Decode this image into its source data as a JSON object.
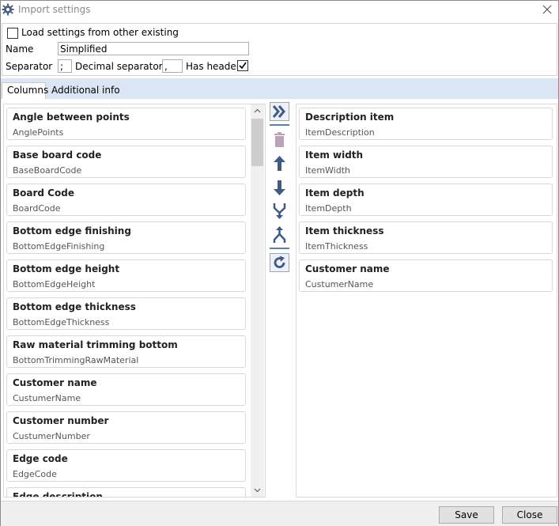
{
  "window": {
    "title": "Import settings"
  },
  "settings": {
    "load_other_label": "Load settings from other existing",
    "load_other_checked": false,
    "name_label": "Name",
    "name_value": "Simplified",
    "separator_label": "Separator",
    "separator_value": ";",
    "decimal_label": "Decimal separator",
    "decimal_value": ",",
    "has_header_label": "Has header",
    "has_header_checked": true
  },
  "tabs": [
    {
      "label": "Columns",
      "active": true
    },
    {
      "label": "Additional info",
      "active": false
    }
  ],
  "available_columns": [
    {
      "title": "Angle between points",
      "key": "AnglePoints"
    },
    {
      "title": "Base board code",
      "key": "BaseBoardCode"
    },
    {
      "title": "Board Code",
      "key": "BoardCode"
    },
    {
      "title": "Bottom edge finishing",
      "key": "BottomEdgeFinishing"
    },
    {
      "title": "Bottom edge height",
      "key": "BottomEdgeHeight"
    },
    {
      "title": "Bottom edge thickness",
      "key": "BottomEdgeThickness"
    },
    {
      "title": "Raw material trimming bottom",
      "key": "BottomTrimmingRawMaterial"
    },
    {
      "title": "Customer name",
      "key": "CustumerName"
    },
    {
      "title": "Customer number",
      "key": "CustumerNumber"
    },
    {
      "title": "Edge code",
      "key": "EdgeCode"
    },
    {
      "title": "Edge description",
      "key": ""
    }
  ],
  "selected_columns": [
    {
      "title": "Description item",
      "key": "ItemDescription"
    },
    {
      "title": "Item width",
      "key": "ItemWidth"
    },
    {
      "title": "Item depth",
      "key": "ItemDepth"
    },
    {
      "title": "Item thickness",
      "key": "ItemThickness"
    },
    {
      "title": "Customer name",
      "key": "CustumerName"
    }
  ],
  "toolbar_icons": [
    "add-all-icon",
    "delete-icon",
    "move-up-icon",
    "move-down-icon",
    "merge-icon",
    "split-icon",
    "refresh-icon"
  ],
  "buttons": {
    "save": "Save",
    "close": "Close"
  },
  "colors": {
    "accent": "#3f5a86",
    "tab_strip": "#dbe6f4"
  }
}
